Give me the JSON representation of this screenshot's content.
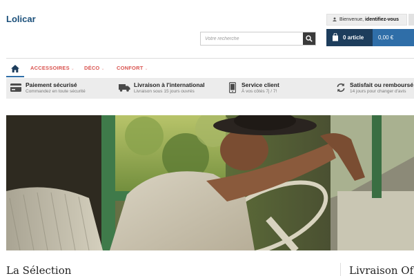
{
  "header": {
    "logo": "Lolicar",
    "login_prefix": "Bienvenue,",
    "login_link": "identifiez-vous",
    "search_placeholder": "Votre recherche",
    "cart_count": "0 article",
    "cart_total": "0,00 €"
  },
  "nav": {
    "items": [
      {
        "label": "ACCESSOIRES"
      },
      {
        "label": "DÉCO"
      },
      {
        "label": "CONFORT"
      }
    ],
    "active": "home"
  },
  "features": [
    {
      "icon": "credit-card-icon",
      "title": "Paiement sécurisé",
      "subtitle": "Commandez en toute sécurité"
    },
    {
      "icon": "truck-icon",
      "title": "Livraison à l'international",
      "subtitle": "Livraison sous 15 jours ouvrés"
    },
    {
      "icon": "phone-icon",
      "title": "Service client",
      "subtitle": "À vos côtés 7j / 7!"
    },
    {
      "icon": "refresh-icon",
      "title": "Satisfait ou remboursé",
      "subtitle": "14 jours pour changer d'avis"
    }
  ],
  "sections": {
    "left_title": "La Sélection",
    "right_title": "Livraison Of"
  },
  "colors": {
    "brand": "#1a4f7a",
    "cart_bg": "#1d3d5c",
    "cart_total_bg": "#2f6ea8",
    "nav_item": "#d9534f",
    "band_bg": "#ececec"
  }
}
